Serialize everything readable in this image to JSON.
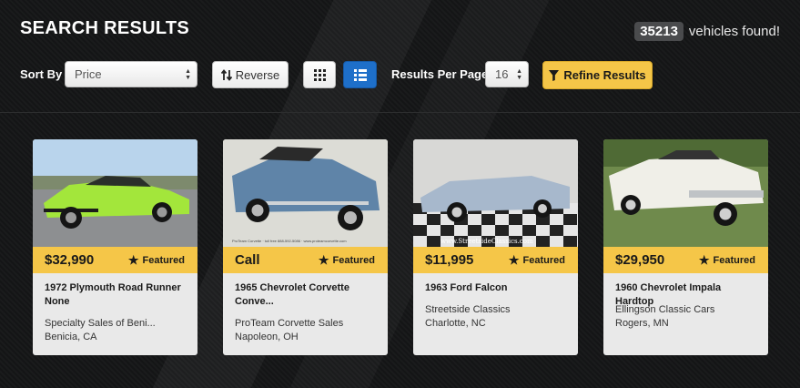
{
  "header": {
    "title": "SEARCH RESULTS",
    "count": "35213",
    "count_suffix": "vehicles found!"
  },
  "toolbar": {
    "sort_label": "Sort By",
    "sort_value": "Price",
    "reverse_label": "Reverse",
    "per_page_label": "Results Per Page",
    "per_page_value": "16",
    "refine_label": "Refine Results",
    "active_view": "list",
    "colors": {
      "accent_yellow": "#f5c648",
      "accent_blue": "#1e6fc9"
    }
  },
  "listings": [
    {
      "price": "$32,990",
      "featured": "Featured",
      "title_line1": "1972 Plymouth Road Runner",
      "title_line2": "None",
      "dealer": "Specialty Sales of Beni...",
      "location": "Benicia, CA",
      "photo_color": "#9fe03a"
    },
    {
      "price": "Call",
      "featured": "Featured",
      "title_line1": "1965 Chevrolet Corvette",
      "title_line2": "Conve...",
      "dealer": "ProTeam Corvette Sales",
      "location": "Napoleon, OH",
      "photo_color": "#5f84a8",
      "photo_caption": "ProTeam Corvette · toll free 888-592-5086 · www.proteamcorvette.com"
    },
    {
      "price": "$11,995",
      "featured": "Featured",
      "title_line1": "1963 Ford Falcon",
      "dealer": "Streetside Classics",
      "location": "Charlotte, NC",
      "photo_color": "#a7b8cc",
      "photo_caption": "www.StreetsideClassics.com"
    },
    {
      "price": "$29,950",
      "featured": "Featured",
      "title_line1": "1960 Chevrolet Impala Hardtop",
      "dealer": "Ellingson Classic Cars",
      "location": "Rogers, MN",
      "photo_color": "#f0efe8"
    }
  ]
}
